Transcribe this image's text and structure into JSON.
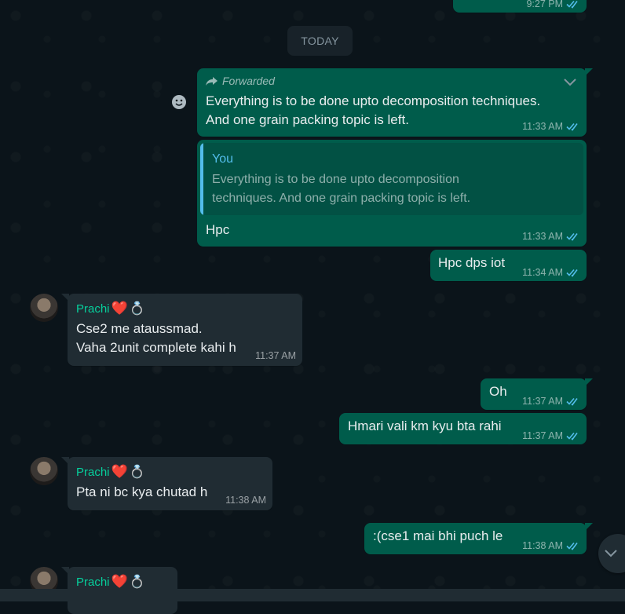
{
  "top_partial": {
    "time": "9:27 PM"
  },
  "date_divider": "TODAY",
  "messages": [
    {
      "forwarded_label": "Forwarded",
      "text_line1": "Everything is to be done upto decomposition techniques.",
      "text_line2": "And one grain packing topic is left.",
      "time": "11:33 AM"
    },
    {
      "quote_author": "You",
      "quote_line1": "Everything is to be done upto decomposition",
      "quote_line2": "techniques. And one grain packing topic is left.",
      "text": "Hpc",
      "time": "11:33 AM"
    },
    {
      "text": "Hpc dps iot",
      "time": "11:34 AM"
    },
    {
      "sender": "Prachi",
      "text_line1": "Cse2 me ataussmad.",
      "text_line2": "Vaha 2unit complete kahi h",
      "time": "11:37 AM"
    },
    {
      "text": "Oh",
      "time": "11:37 AM"
    },
    {
      "text": "Hmari vali km kyu bta rahi",
      "time": "11:37 AM"
    },
    {
      "sender": "Prachi",
      "text": "Pta ni bc kya chutad h",
      "time": "11:38 AM"
    },
    {
      "text": ":(cse1 mai bhi puch le",
      "time": "11:38 AM"
    },
    {
      "sender": "Prachi"
    }
  ],
  "colors": {
    "outgoing": "#005c4b",
    "incoming": "#202c33",
    "sender_name": "#06cf9c",
    "read_ticks": "#53bdeb"
  },
  "icons": [
    "forward-icon",
    "chevron-down-icon",
    "emoji-react-icon",
    "double-tick-icon",
    "heart-emoji",
    "ring-emoji",
    "scroll-down-icon"
  ]
}
